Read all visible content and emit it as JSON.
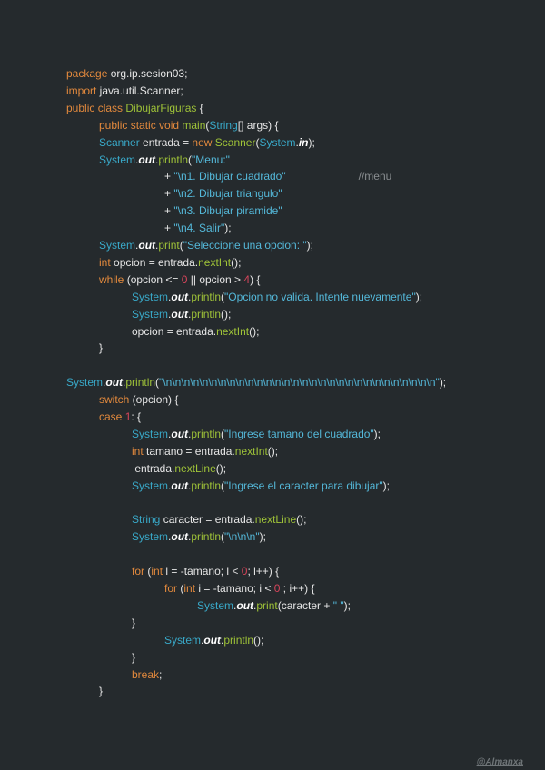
{
  "code_lines": [
    {
      "indent": 0,
      "tokens": [
        [
          "kw",
          "package"
        ],
        [
          "pln",
          " org.ip.sesion03;"
        ]
      ]
    },
    {
      "indent": 0,
      "tokens": [
        [
          "kw",
          "import"
        ],
        [
          "pln",
          " java.util.Scanner;"
        ]
      ]
    },
    {
      "indent": 0,
      "tokens": [
        [
          "kw",
          "public class"
        ],
        [
          "pln",
          " "
        ],
        [
          "fn",
          "DibujarFiguras"
        ],
        [
          "pln",
          " {"
        ]
      ]
    },
    {
      "indent": 1,
      "tokens": [
        [
          "kw",
          "public static void"
        ],
        [
          "pln",
          " "
        ],
        [
          "fn",
          "main"
        ],
        [
          "pln",
          "("
        ],
        [
          "typ",
          "String"
        ],
        [
          "pln",
          "[] args) {"
        ]
      ]
    },
    {
      "indent": 1,
      "tokens": [
        [
          "typ",
          "Scanner"
        ],
        [
          "pln",
          " entrada = "
        ],
        [
          "kw",
          "new"
        ],
        [
          "pln",
          " "
        ],
        [
          "fn",
          "Scanner"
        ],
        [
          "pln",
          "("
        ],
        [
          "typ",
          "System"
        ],
        [
          "pln",
          "."
        ],
        [
          "out",
          "in"
        ],
        [
          "pln",
          ");"
        ]
      ]
    },
    {
      "indent": 1,
      "tokens": [
        [
          "typ",
          "System"
        ],
        [
          "pln",
          "."
        ],
        [
          "out",
          "out"
        ],
        [
          "pln",
          "."
        ],
        [
          "fn",
          "println"
        ],
        [
          "pln",
          "("
        ],
        [
          "str",
          "\"Menu:\""
        ]
      ]
    },
    {
      "indent": 3,
      "tokens": [
        [
          "pln",
          "+ "
        ],
        [
          "str",
          "\"\\n1. Dibujar cuadrado\""
        ],
        [
          "pln",
          "                        "
        ],
        [
          "cm",
          "//menu"
        ]
      ]
    },
    {
      "indent": 3,
      "tokens": [
        [
          "pln",
          "+ "
        ],
        [
          "str",
          "\"\\n2. Dibujar triangulo\""
        ]
      ]
    },
    {
      "indent": 3,
      "tokens": [
        [
          "pln",
          "+ "
        ],
        [
          "str",
          "\"\\n3. Dibujar piramide\""
        ]
      ]
    },
    {
      "indent": 3,
      "tokens": [
        [
          "pln",
          "+ "
        ],
        [
          "str",
          "\"\\n4. Salir\""
        ],
        [
          "pln",
          ");"
        ]
      ]
    },
    {
      "indent": 1,
      "tokens": [
        [
          "typ",
          "System"
        ],
        [
          "pln",
          "."
        ],
        [
          "out",
          "out"
        ],
        [
          "pln",
          "."
        ],
        [
          "fn",
          "print"
        ],
        [
          "pln",
          "("
        ],
        [
          "str",
          "\"Seleccione una opcion: \""
        ],
        [
          "pln",
          ");"
        ]
      ]
    },
    {
      "indent": 1,
      "tokens": [
        [
          "kw",
          "int"
        ],
        [
          "pln",
          " opcion = entrada."
        ],
        [
          "fn",
          "nextInt"
        ],
        [
          "pln",
          "();"
        ]
      ]
    },
    {
      "indent": 1,
      "tokens": [
        [
          "kw",
          "while"
        ],
        [
          "pln",
          " (opcion <= "
        ],
        [
          "num",
          "0"
        ],
        [
          "pln",
          " || opcion > "
        ],
        [
          "num",
          "4"
        ],
        [
          "pln",
          ") {"
        ]
      ]
    },
    {
      "indent": 2,
      "tokens": [
        [
          "typ",
          "System"
        ],
        [
          "pln",
          "."
        ],
        [
          "out",
          "out"
        ],
        [
          "pln",
          "."
        ],
        [
          "fn",
          "println"
        ],
        [
          "pln",
          "("
        ],
        [
          "str",
          "\"Opcion no valida. Intente nuevamente\""
        ],
        [
          "pln",
          ");"
        ]
      ]
    },
    {
      "indent": 2,
      "tokens": [
        [
          "typ",
          "System"
        ],
        [
          "pln",
          "."
        ],
        [
          "out",
          "out"
        ],
        [
          "pln",
          "."
        ],
        [
          "fn",
          "println"
        ],
        [
          "pln",
          "();"
        ]
      ]
    },
    {
      "indent": 2,
      "tokens": [
        [
          "pln",
          "opcion = entrada."
        ],
        [
          "fn",
          "nextInt"
        ],
        [
          "pln",
          "();"
        ]
      ]
    },
    {
      "indent": 1,
      "tokens": [
        [
          "pln",
          "}"
        ]
      ]
    },
    {
      "indent": 0,
      "tokens": []
    },
    {
      "indent": 0,
      "tokens": [
        [
          "typ",
          "System"
        ],
        [
          "pln",
          "."
        ],
        [
          "out",
          "out"
        ],
        [
          "pln",
          "."
        ],
        [
          "fn",
          "println"
        ],
        [
          "pln",
          "("
        ],
        [
          "str",
          "\"\\n\\n\\n\\n\\n\\n\\n\\n\\n\\n\\n\\n\\n\\n\\n\\n\\n\\n\\n\\n\\n\\n\\n\\n\\n\\n\\n\\n\\n\\n\""
        ],
        [
          "pln",
          ");"
        ]
      ]
    },
    {
      "indent": 1,
      "tokens": [
        [
          "kw",
          "switch"
        ],
        [
          "pln",
          " (opcion) {"
        ]
      ]
    },
    {
      "indent": 1,
      "tokens": [
        [
          "kw",
          "case"
        ],
        [
          "pln",
          " "
        ],
        [
          "num",
          "1"
        ],
        [
          "pln",
          ": {"
        ]
      ]
    },
    {
      "indent": 2,
      "tokens": [
        [
          "typ",
          "System"
        ],
        [
          "pln",
          "."
        ],
        [
          "out",
          "out"
        ],
        [
          "pln",
          "."
        ],
        [
          "fn",
          "println"
        ],
        [
          "pln",
          "("
        ],
        [
          "str",
          "\"Ingrese tamano del cuadrado\""
        ],
        [
          "pln",
          ");"
        ]
      ]
    },
    {
      "indent": 2,
      "tokens": [
        [
          "kw",
          "int"
        ],
        [
          "pln",
          " tamano = entrada."
        ],
        [
          "fn",
          "nextInt"
        ],
        [
          "pln",
          "();"
        ]
      ]
    },
    {
      "indent": 2,
      "tokens": [
        [
          "pln",
          " entrada."
        ],
        [
          "fn",
          "nextLine"
        ],
        [
          "pln",
          "();"
        ]
      ]
    },
    {
      "indent": 2,
      "tokens": [
        [
          "typ",
          "System"
        ],
        [
          "pln",
          "."
        ],
        [
          "out",
          "out"
        ],
        [
          "pln",
          "."
        ],
        [
          "fn",
          "println"
        ],
        [
          "pln",
          "("
        ],
        [
          "str",
          "\"Ingrese el caracter para dibujar\""
        ],
        [
          "pln",
          ");"
        ]
      ]
    },
    {
      "indent": 0,
      "tokens": []
    },
    {
      "indent": 2,
      "tokens": [
        [
          "typ",
          "String"
        ],
        [
          "pln",
          " caracter = entrada."
        ],
        [
          "fn",
          "nextLine"
        ],
        [
          "pln",
          "();"
        ]
      ]
    },
    {
      "indent": 2,
      "tokens": [
        [
          "typ",
          "System"
        ],
        [
          "pln",
          "."
        ],
        [
          "out",
          "out"
        ],
        [
          "pln",
          "."
        ],
        [
          "fn",
          "println"
        ],
        [
          "pln",
          "("
        ],
        [
          "str",
          "\"\\n\\n\\n\""
        ],
        [
          "pln",
          ");"
        ]
      ]
    },
    {
      "indent": 0,
      "tokens": []
    },
    {
      "indent": 2,
      "tokens": [
        [
          "kw",
          "for"
        ],
        [
          "pln",
          " ("
        ],
        [
          "kw",
          "int"
        ],
        [
          "pln",
          " l = -tamano; l < "
        ],
        [
          "num",
          "0"
        ],
        [
          "pln",
          "; l++) {"
        ]
      ]
    },
    {
      "indent": 3,
      "tokens": [
        [
          "kw",
          "for"
        ],
        [
          "pln",
          " ("
        ],
        [
          "kw",
          "int"
        ],
        [
          "pln",
          " i = -tamano; i < "
        ],
        [
          "num",
          "0"
        ],
        [
          "pln",
          " ; i++) {"
        ]
      ]
    },
    {
      "indent": 4,
      "tokens": [
        [
          "typ",
          "System"
        ],
        [
          "pln",
          "."
        ],
        [
          "out",
          "out"
        ],
        [
          "pln",
          "."
        ],
        [
          "fn",
          "print"
        ],
        [
          "pln",
          "(caracter + "
        ],
        [
          "str",
          "\" \""
        ],
        [
          "pln",
          ");"
        ]
      ]
    },
    {
      "indent": 2,
      "tokens": [
        [
          "pln",
          "}"
        ]
      ]
    },
    {
      "indent": 3,
      "tokens": [
        [
          "typ",
          "System"
        ],
        [
          "pln",
          "."
        ],
        [
          "out",
          "out"
        ],
        [
          "pln",
          "."
        ],
        [
          "fn",
          "println"
        ],
        [
          "pln",
          "();"
        ]
      ]
    },
    {
      "indent": 2,
      "tokens": [
        [
          "pln",
          "}"
        ]
      ]
    },
    {
      "indent": 2,
      "tokens": [
        [
          "kw",
          "break"
        ],
        [
          "pln",
          ";"
        ]
      ]
    },
    {
      "indent": 1,
      "tokens": [
        [
          "pln",
          "}"
        ]
      ]
    }
  ],
  "watermark": "@Almanxa"
}
